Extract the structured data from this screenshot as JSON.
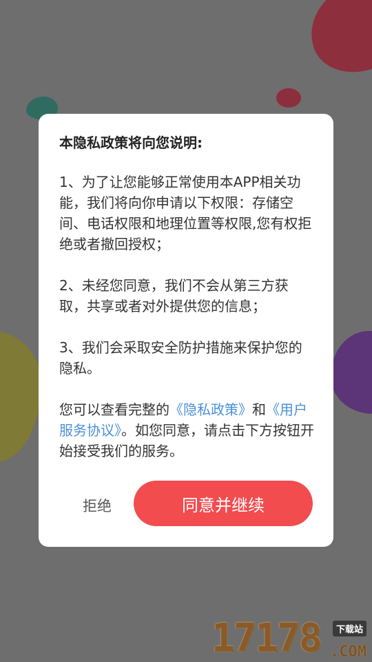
{
  "dialog": {
    "title": "本隐私政策将向您说明:",
    "para1": "1、为了让您能够正常使用本APP相关功能，我们将向你申请以下权限：存储空间、电话权限和地理位置等权限,您有权拒绝或者撤回授权；",
    "para2": "2、未经您同意，我们不会从第三方获取，共享或者对外提供您的信息；",
    "para3": "3、我们会采取安全防护措施来保护您的隐私。",
    "para4_prefix": "您可以查看完整的",
    "privacy_link": "《隐私政策》",
    "para4_and": "和",
    "service_link": "《用户服务协议》",
    "para4_suffix": "。如您同意，请点击下方按钮开始接受我们的服务。",
    "reject_label": "拒绝",
    "agree_label": "同意并继续"
  },
  "watermark": {
    "digits": "17178",
    "tag": "下载站",
    "domain": ".COM"
  },
  "colors": {
    "accent": "#f24c4f",
    "link": "#4a90d9",
    "overlay": "#6e6e6e"
  }
}
